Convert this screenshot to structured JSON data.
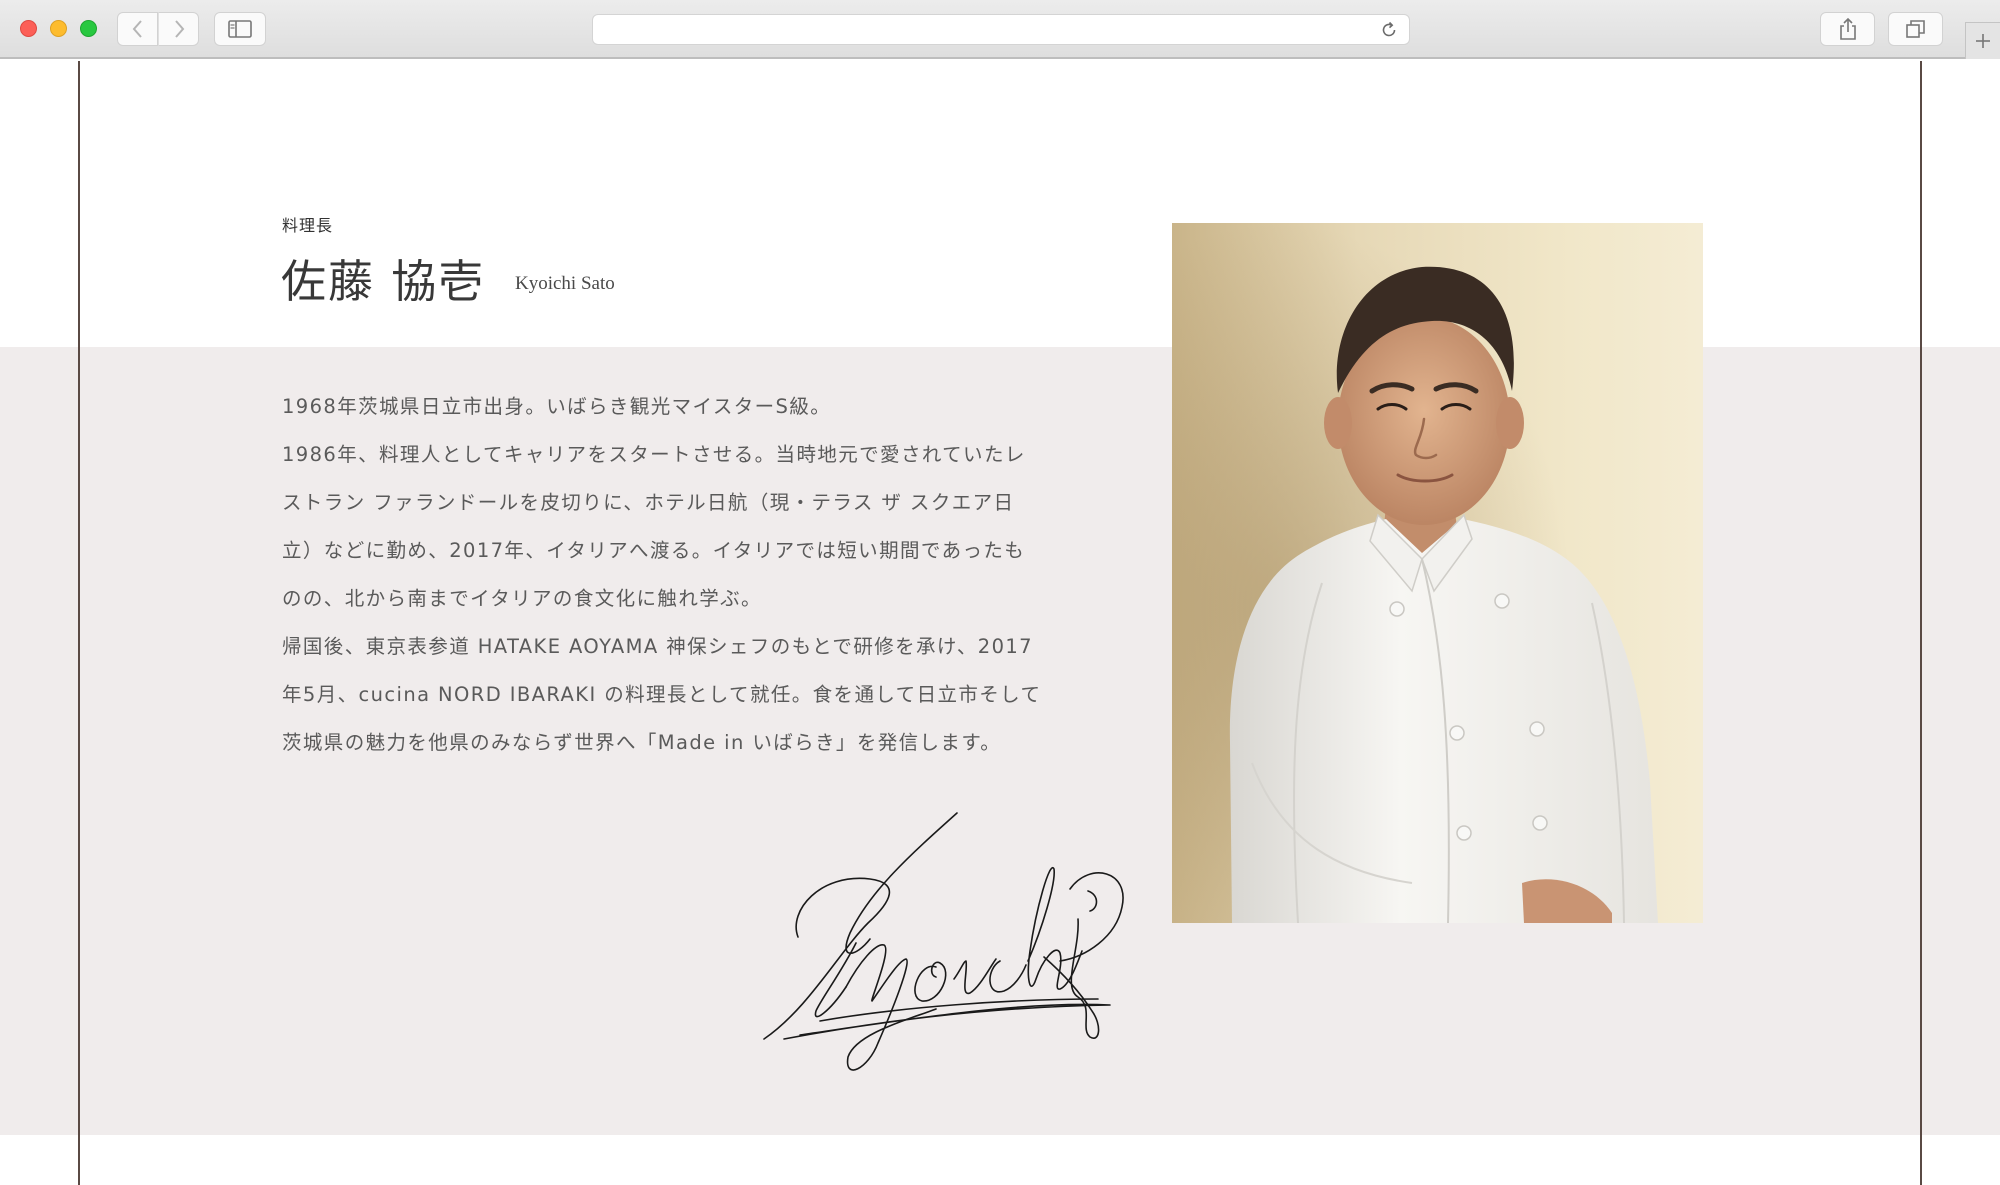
{
  "browser": {
    "address_value": "",
    "icons": {
      "back": "chevron-left-icon",
      "forward": "chevron-right-icon",
      "sidebar": "sidebar-icon",
      "reload": "reload-icon",
      "share": "share-icon",
      "tabs": "tabs-overview-icon",
      "new_tab": "plus-icon"
    },
    "colors": {
      "close": "#fc5f57",
      "minimize": "#fdbc2e",
      "zoom": "#28c840"
    }
  },
  "profile": {
    "role": "料理長",
    "name_jp": "佐藤 協壱",
    "name_en": "Kyoichi Sato",
    "bio_lines": [
      "1968年茨城県日立市出身。いばらき観光マイスターS級。",
      "1986年、料理人としてキャリアをスタートさせる。当時地元で愛されていたレ",
      "ストラン ファランドールを皮切りに、ホテル日航（現・テラス ザ スクエア日",
      "立）などに勤め、2017年、イタリアへ渡る。イタリアでは短い期間であったも",
      "のの、北から南までイタリアの食文化に触れ学ぶ。",
      "帰国後、東京表参道 HATAKE AOYAMA 神保シェフのもとで研修を承け、2017",
      "年5月、cucina NORD IBARAKI の料理長として就任。食を通して日立市そして",
      "茨城県の魅力を他県のみならず世界へ「Made in いばらき」を発信します。"
    ],
    "signature": "Kyoichi",
    "photo": "chef-portrait"
  },
  "colors": {
    "band_background": "#f0ecec",
    "frame_line": "#5a4a44",
    "text": "#5a5a5a",
    "heading": "#383838"
  }
}
